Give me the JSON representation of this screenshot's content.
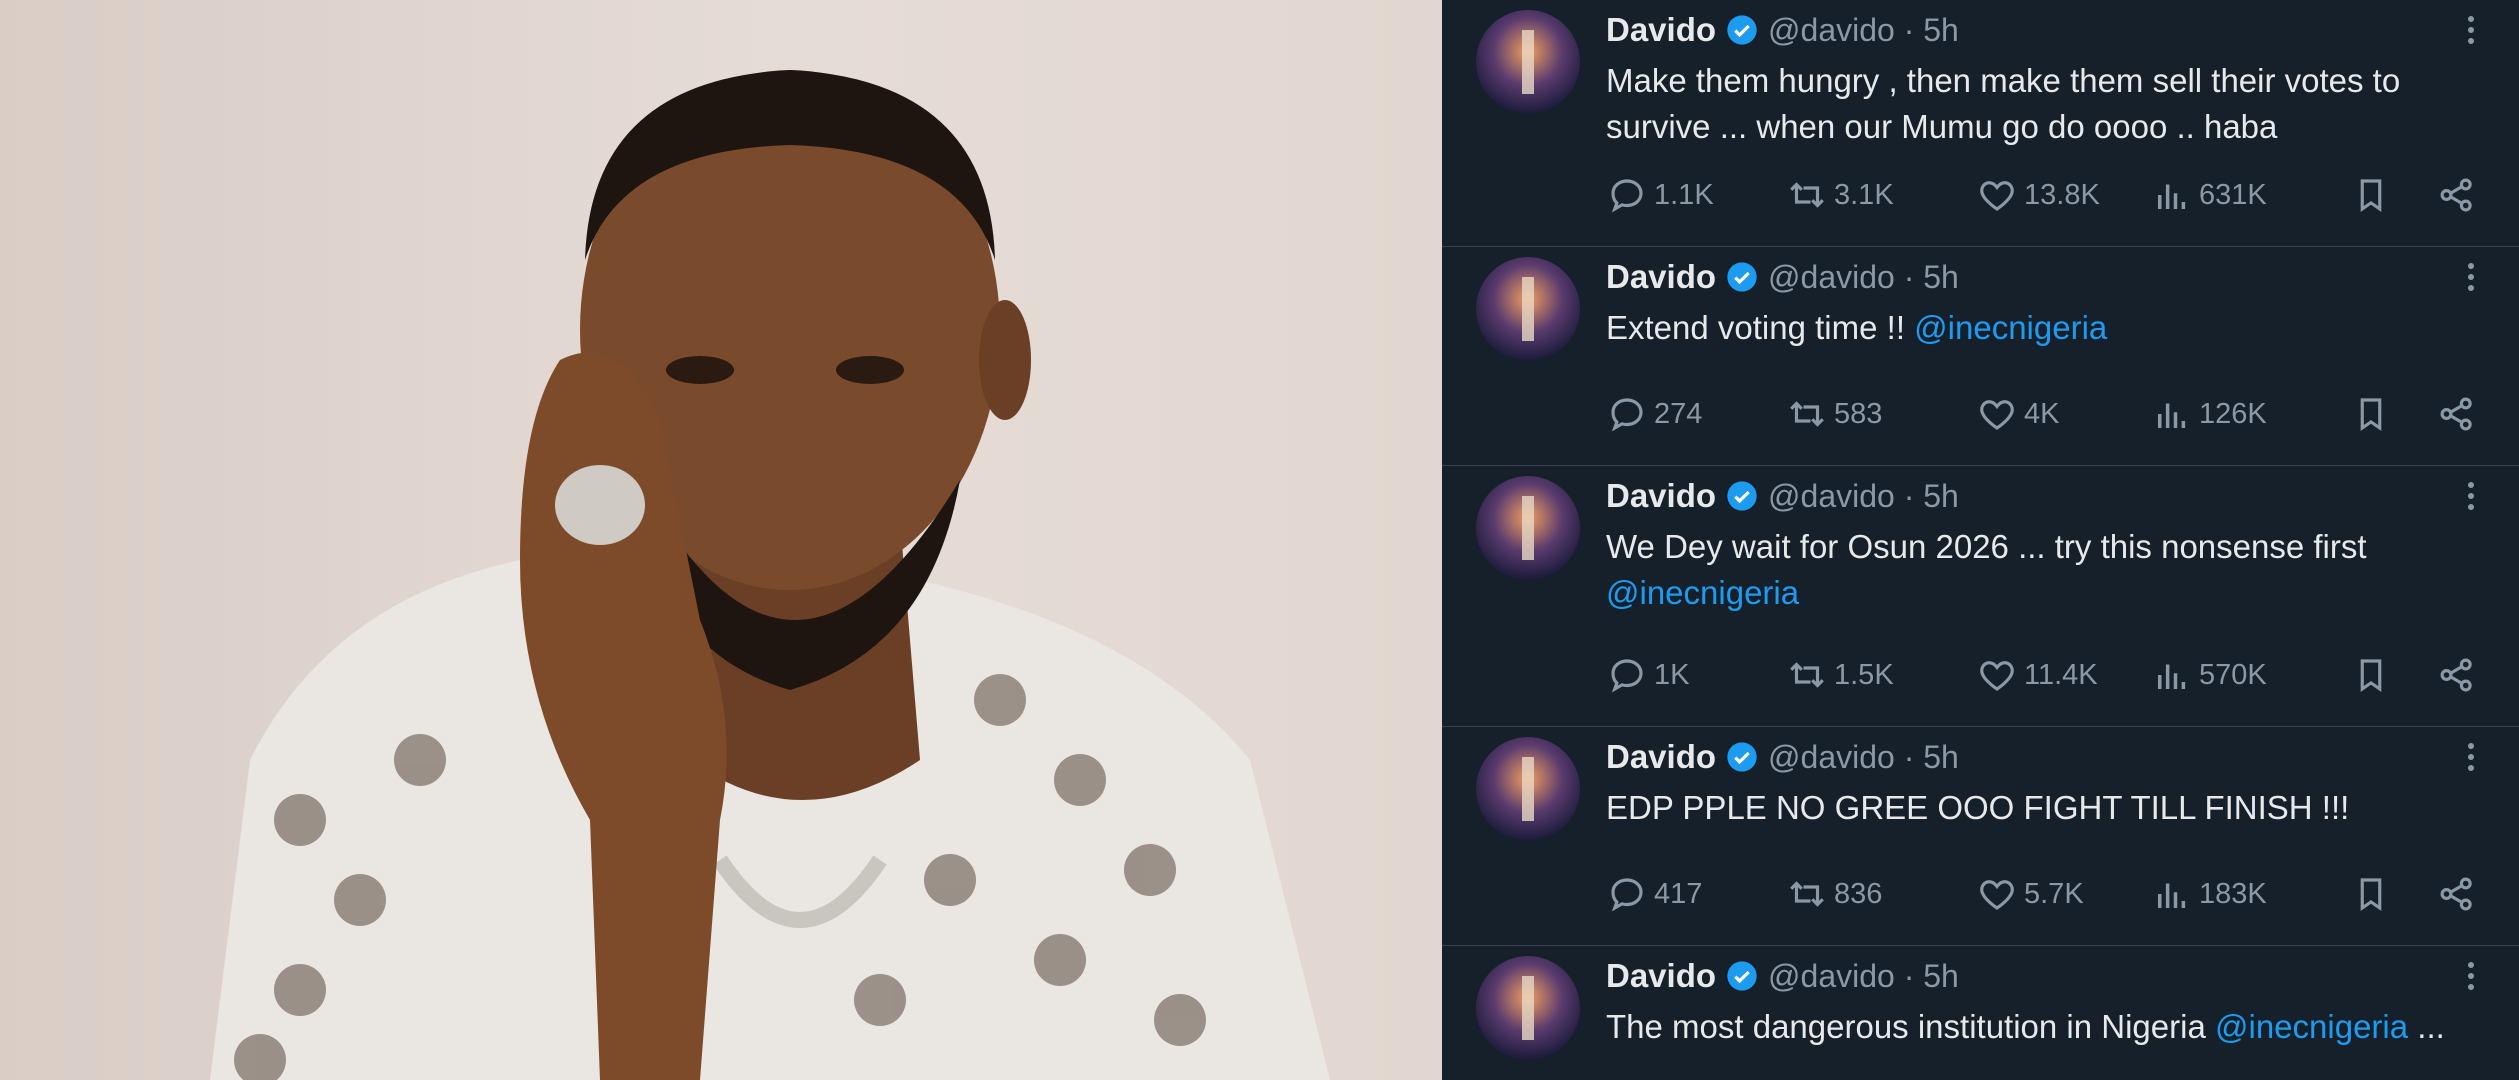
{
  "tweets": [
    {
      "name": "Davido",
      "handle": "@davido · 5h",
      "text_parts": [
        "Make them hungry , then make them sell their votes to survive ... when our Mumu go do oooo .. haba",
        ""
      ],
      "replies": "1.1K",
      "retweets": "3.1K",
      "likes": "13.8K",
      "views": "631K"
    },
    {
      "name": "Davido",
      "handle": "@davido · 5h",
      "text_parts": [
        "Extend voting time !! ",
        "@inecnigeria"
      ],
      "replies": "274",
      "retweets": "583",
      "likes": "4K",
      "views": "126K"
    },
    {
      "name": "Davido",
      "handle": "@davido · 5h",
      "text_parts": [
        "We Dey wait for Osun 2026 ... try this nonsense first ",
        "@inecnigeria"
      ],
      "replies": "1K",
      "retweets": "1.5K",
      "likes": "11.4K",
      "views": "570K"
    },
    {
      "name": "Davido",
      "handle": "@davido · 5h",
      "text_parts": [
        "EDP PPLE NO GREE OOO FIGHT TILL FINISH !!!",
        ""
      ],
      "replies": "417",
      "retweets": "836",
      "likes": "5.7K",
      "views": "183K"
    },
    {
      "name": "Davido",
      "handle": "@davido · 5h",
      "text_parts": [
        "The most dangerous institution in Nigeria ",
        "@inecnigeria",
        " ..."
      ]
    }
  ],
  "icons": {
    "reply": "reply-icon",
    "retweet": "retweet-icon",
    "like": "like-icon",
    "views": "views-icon",
    "bookmark": "bookmark-icon",
    "share": "share-icon",
    "verified": "verified-badge-icon",
    "more": "more-options-icon"
  },
  "colors": {
    "background": "#15202b",
    "text": "#e7e9ea",
    "secondary": "#8b98a5",
    "accent": "#1d9bf0",
    "divider": "#38444d"
  }
}
